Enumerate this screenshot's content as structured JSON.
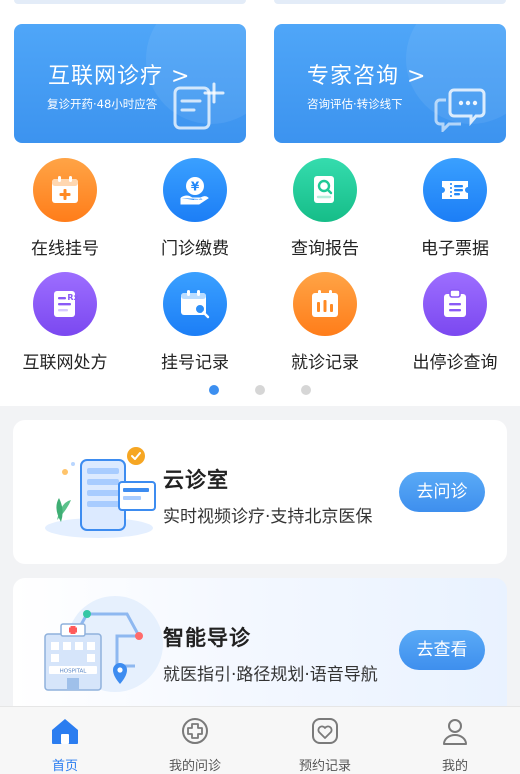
{
  "banners": [
    {
      "title": "互联网诊疗 >",
      "subtitle": "复诊开药·48小时应答",
      "icon": "add-document-icon"
    },
    {
      "title": "专家咨询 >",
      "subtitle": "咨询评估·转诊线下",
      "icon": "chat-bubble-icon"
    }
  ],
  "grid": [
    {
      "label": "在线挂号",
      "icon": "calendar-plus-icon",
      "color": "#ff8a24"
    },
    {
      "label": "门诊缴费",
      "icon": "yuan-hand-icon",
      "color": "#2388f8"
    },
    {
      "label": "查询报告",
      "icon": "report-search-icon",
      "color": "#20c996"
    },
    {
      "label": "电子票据",
      "icon": "ticket-icon",
      "color": "#2388f8"
    },
    {
      "label": "互联网处方",
      "icon": "prescription-icon",
      "color": "#8a5af6"
    },
    {
      "label": "挂号记录",
      "icon": "calendar-search-icon",
      "color": "#2d8ff8"
    },
    {
      "label": "就诊记录",
      "icon": "records-calendar-icon",
      "color": "#ff8a24"
    },
    {
      "label": "出停诊查询",
      "icon": "clipboard-icon",
      "color": "#8a5af6"
    }
  ],
  "pagination": {
    "total": 3,
    "active": 1
  },
  "cards": [
    {
      "title": "云诊室",
      "desc": "实时视频诊疗·支持北京医保",
      "button": "去问诊"
    },
    {
      "title": "智能导诊",
      "desc": "就医指引·路径规划·语音导航",
      "button": "去查看"
    }
  ],
  "tabbar": [
    {
      "label": "首页",
      "icon": "home-icon",
      "active": true
    },
    {
      "label": "我的问诊",
      "icon": "medical-cross-icon",
      "active": false
    },
    {
      "label": "预约记录",
      "icon": "heart-icon",
      "active": false
    },
    {
      "label": "我的",
      "icon": "person-icon",
      "active": false
    }
  ],
  "colors": {
    "accent": "#2b7df0",
    "banner": "#4a9ff5",
    "background": "#f2f3f5"
  }
}
